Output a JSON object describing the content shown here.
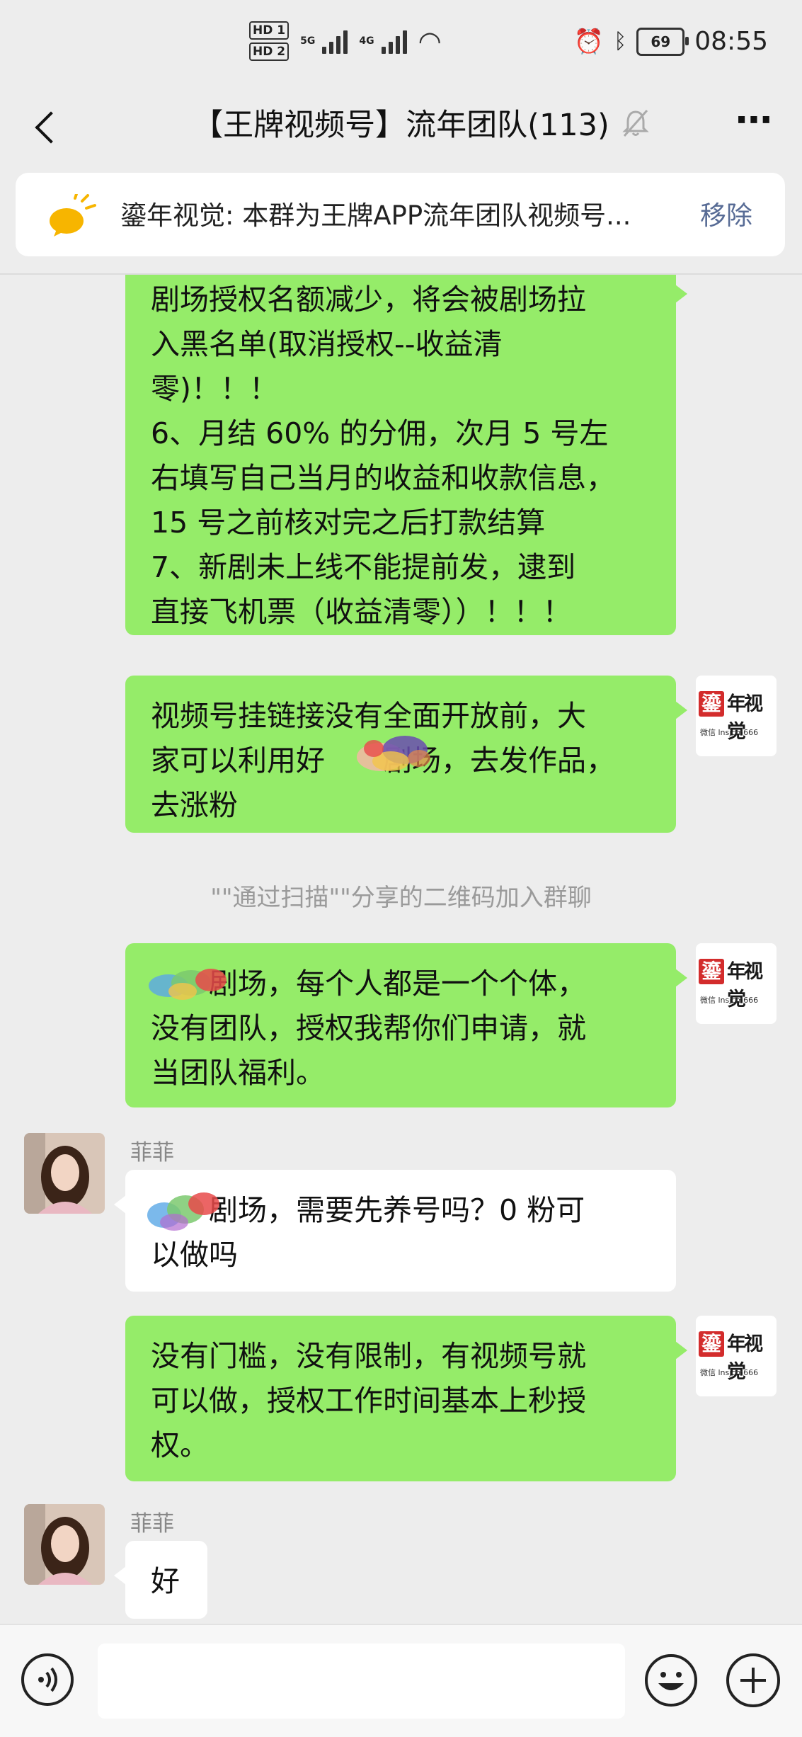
{
  "status_bar": {
    "hd1": "HD 1",
    "hd2": "HD 2",
    "net1": "5G",
    "net2": "4G",
    "battery": "69",
    "time": "08:55"
  },
  "header": {
    "title": "【王牌视频号】流年团队(113)"
  },
  "notice": {
    "text": "鎏年视觉: 本群为王牌APP流年团队视频号...",
    "remove_label": "移除"
  },
  "messages": [
    {
      "sender": "",
      "text": "剧场授权名额减少，将会被剧场拉\n入黑名单(取消授权--收益清\n零)！！！\n6、月结 60% 的分佣，次月 5 号左\n右填写自己当月的收益和收款信息，\n15 号之前核对完之后打款结算\n7、新剧未上线不能提前发，逮到\n直接飞机票（收益清零））！！！"
    },
    {
      "sender": "",
      "text": "视频号挂链接没有全面开放前，大\n家可以利用好　　剧场，去发作品，\n去涨粉"
    },
    {
      "sender": "",
      "text": "　　剧场，每个人都是一个个体，\n没有团队，授权我帮你们申请，就\n当团队福利。"
    },
    {
      "sender": "菲菲",
      "text": "　　剧场，需要先养号吗？0 粉可\n以做吗"
    },
    {
      "sender": "",
      "text": "没有门槛，没有限制，有视频号就\n可以做，授权工作时间基本上秒授\n权。"
    },
    {
      "sender": "菲菲",
      "text": "好"
    }
  ],
  "system_message": "\"\"通过扫描\"\"分享的二维码加入群聊",
  "my_avatar": {
    "brand": "鎏年视觉",
    "wechat": "微信 lnsjcm666"
  },
  "colors": {
    "outgoing_bubble": "#95ec69",
    "incoming_bubble": "#ffffff",
    "link_blue": "#576b95",
    "background": "#ededed"
  },
  "icons": [
    "back-arrow-icon",
    "mute-bell-icon",
    "more-icon",
    "notice-bulb-icon",
    "voice-icon",
    "emoji-icon",
    "plus-icon"
  ]
}
